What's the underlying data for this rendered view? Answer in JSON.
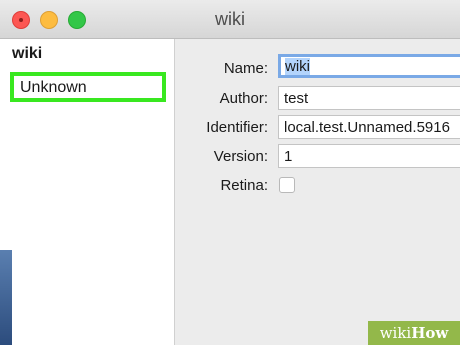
{
  "window": {
    "title": "wiki"
  },
  "sidebar": {
    "header": "wiki",
    "items": [
      {
        "label": "Unknown"
      }
    ]
  },
  "form": {
    "name": {
      "label": "Name:",
      "value": "wiki"
    },
    "author": {
      "label": "Author:",
      "value": "test"
    },
    "identifier": {
      "label": "Identifier:",
      "value": "local.test.Unnamed.5916"
    },
    "version": {
      "label": "Version:",
      "value": "1"
    },
    "retina": {
      "label": "Retina:",
      "checked": false
    }
  },
  "watermark": {
    "prefix": "wiki",
    "suffix": "How"
  },
  "colors": {
    "highlight": "#39e820",
    "selection": "#b3d4fc",
    "focus_ring": "#7aa9e6"
  }
}
